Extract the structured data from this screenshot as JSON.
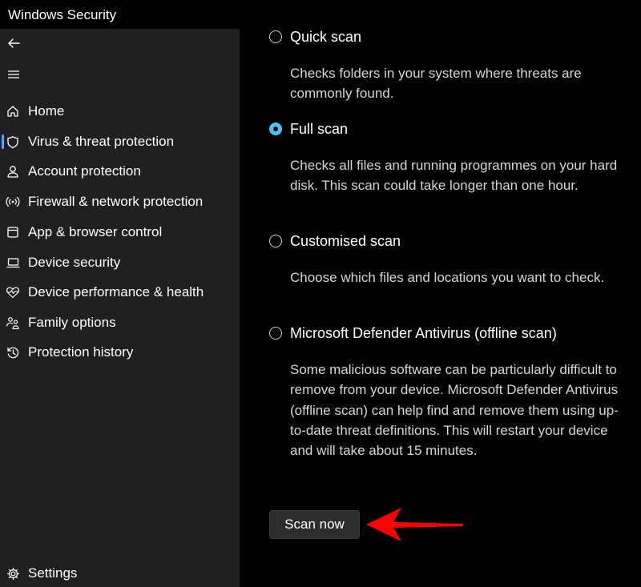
{
  "window": {
    "title": "Windows Security"
  },
  "sidebar": {
    "back_icon": "back-arrow-icon",
    "menu_icon": "hamburger-menu-icon",
    "items": [
      {
        "label": "Home",
        "icon": "home-icon"
      },
      {
        "label": "Virus & threat protection",
        "icon": "shield-icon",
        "selected": true
      },
      {
        "label": "Account protection",
        "icon": "person-icon"
      },
      {
        "label": "Firewall & network protection",
        "icon": "wifi-signal-icon"
      },
      {
        "label": "App & browser control",
        "icon": "app-window-icon"
      },
      {
        "label": "Device security",
        "icon": "laptop-icon"
      },
      {
        "label": "Device performance & health",
        "icon": "heart-pulse-icon"
      },
      {
        "label": "Family options",
        "icon": "family-icon"
      },
      {
        "label": "Protection history",
        "icon": "history-icon"
      }
    ],
    "settings": {
      "label": "Settings",
      "icon": "gear-icon"
    }
  },
  "scan_options": [
    {
      "label": "Quick scan",
      "description": "Checks folders in your system where threats are commonly found.",
      "checked": false
    },
    {
      "label": "Full scan",
      "description": "Checks all files and running programmes on your hard disk. This scan could take longer than one hour.",
      "checked": true
    },
    {
      "label": "Customised scan",
      "description": "Choose which files and locations you want to check.",
      "checked": false
    },
    {
      "label": "Microsoft Defender Antivirus (offline scan)",
      "description": "Some malicious software can be particularly difficult to remove from your device. Microsoft Defender Antivirus (offline scan) can help find and remove them using up-to-date threat definitions. This will restart your device and will take about 15 minutes.",
      "checked": false
    }
  ],
  "actions": {
    "scan_now_label": "Scan now"
  },
  "colors": {
    "accent": "#4cc2ff",
    "annotation_arrow": "#ff0000",
    "sidebar_bg": "#202020",
    "main_bg": "#000000"
  }
}
